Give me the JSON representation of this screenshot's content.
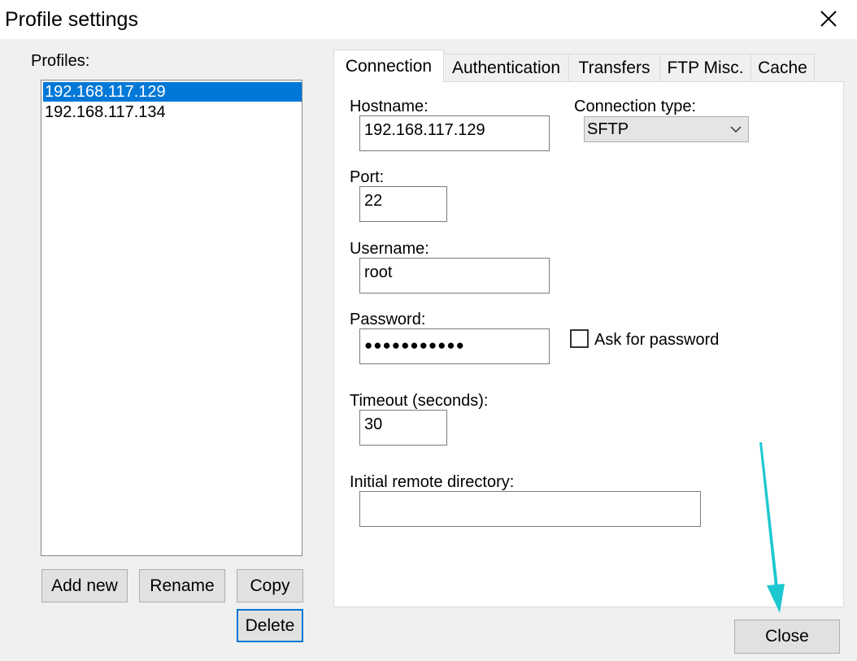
{
  "window": {
    "title": "Profile settings"
  },
  "profiles": {
    "label": "Profiles:",
    "items": [
      "192.168.117.129",
      "192.168.117.134"
    ],
    "selected_index": 0
  },
  "buttons": {
    "add_new": "Add new",
    "rename": "Rename",
    "copy": "Copy",
    "delete": "Delete",
    "close": "Close"
  },
  "tabs": [
    "Connection",
    "Authentication",
    "Transfers",
    "FTP Misc.",
    "Cache"
  ],
  "active_tab": "Connection",
  "connection": {
    "hostname_label": "Hostname:",
    "hostname_value": "192.168.117.129",
    "connection_type_label": "Connection type:",
    "connection_type_value": "SFTP",
    "port_label": "Port:",
    "port_value": "22",
    "username_label": "Username:",
    "username_value": "root",
    "password_label": "Password:",
    "password_masked": "●●●●●●●●●●●",
    "ask_for_password_label": "Ask for password",
    "ask_for_password_checked": false,
    "timeout_label": "Timeout (seconds):",
    "timeout_value": "30",
    "initial_dir_label": "Initial remote directory:",
    "initial_dir_value": ""
  },
  "colors": {
    "selection": "#0078d7",
    "annotation_arrow": "#1ec8d0",
    "window_bg": "#f0f0f0"
  }
}
